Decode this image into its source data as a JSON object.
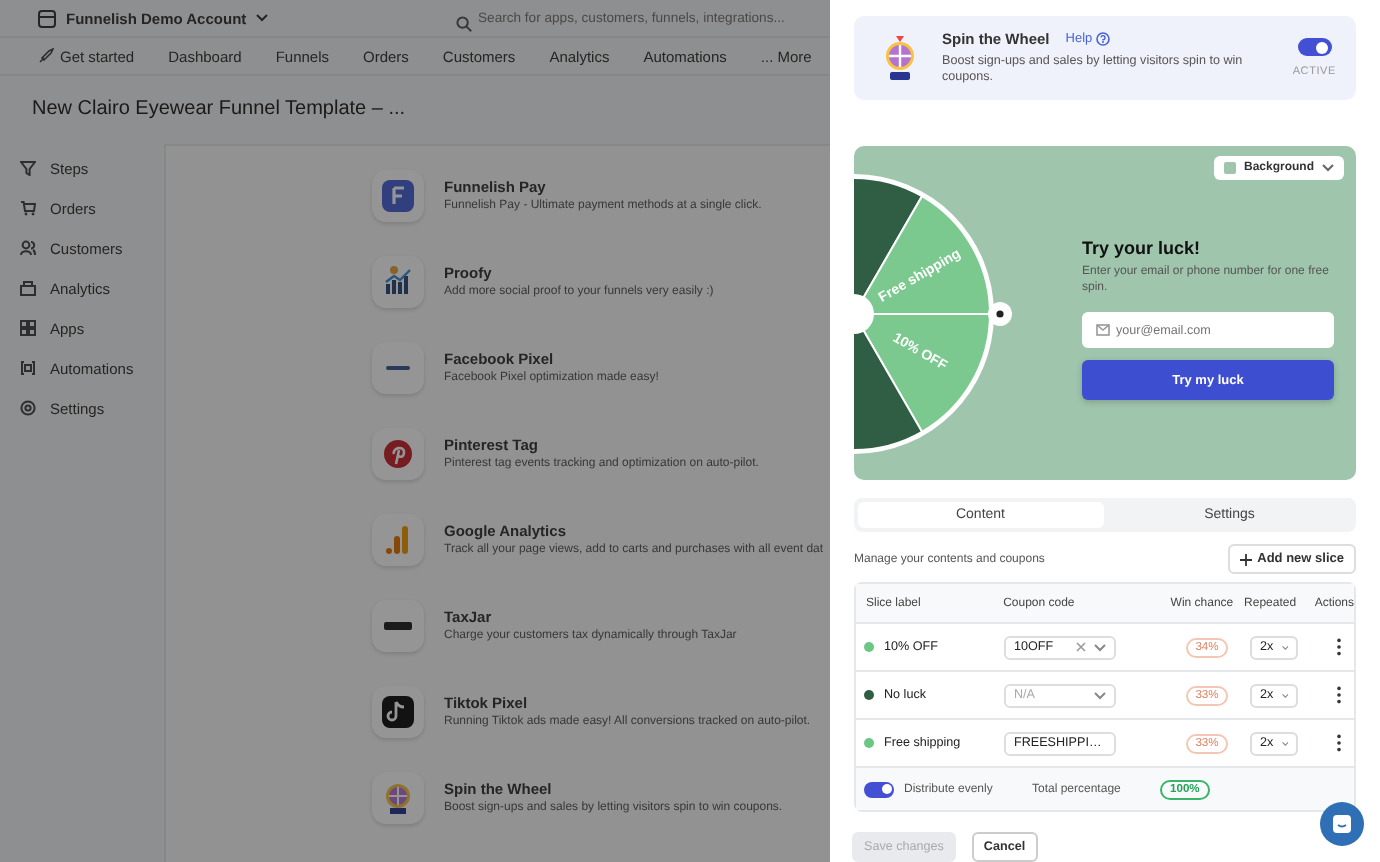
{
  "account": {
    "name": "Funnelish Demo Account"
  },
  "search": {
    "placeholder": "Search for apps, customers, funnels, integrations..."
  },
  "nav": [
    {
      "label": "Get started"
    },
    {
      "label": "Dashboard"
    },
    {
      "label": "Funnels"
    },
    {
      "label": "Orders"
    },
    {
      "label": "Customers"
    },
    {
      "label": "Analytics"
    },
    {
      "label": "Automations"
    },
    {
      "label": "... More"
    }
  ],
  "page_title": "New Clairo Eyewear Funnel Template – ...",
  "sidebar": {
    "items": [
      {
        "label": "Steps"
      },
      {
        "label": "Orders"
      },
      {
        "label": "Customers"
      },
      {
        "label": "Analytics"
      },
      {
        "label": "Apps"
      },
      {
        "label": "Automations"
      },
      {
        "label": "Settings"
      }
    ]
  },
  "apps": [
    {
      "name": "Funnelish Pay",
      "description": "Funnelish Pay - Ultimate payment methods at a single click."
    },
    {
      "name": "Proofy",
      "description": "Add more social proof to your funnels very easily :)"
    },
    {
      "name": "Facebook Pixel",
      "description": "Facebook Pixel optimization made easy!"
    },
    {
      "name": "Pinterest Tag",
      "description": "Pinterest tag events tracking and optimization on auto-pilot."
    },
    {
      "name": "Google Analytics",
      "description": "Track all your page views, add to carts and purchases with all event dat"
    },
    {
      "name": "TaxJar",
      "description": "Charge your customers tax dynamically through TaxJar"
    },
    {
      "name": "Tiktok Pixel",
      "description": "Running Tiktok ads made easy! All conversions tracked on auto-pilot."
    },
    {
      "name": "Spin the Wheel",
      "description": "Boost sign-ups and sales by letting visitors spin to win coupons."
    }
  ],
  "drawer": {
    "app": {
      "name": "Spin the Wheel",
      "help": "Help",
      "description": "Boost sign-ups and sales by letting visitors spin to win coupons.",
      "active": true,
      "status": "ACTIVE"
    },
    "preview": {
      "background_menu": "Background",
      "wheel_labels": [
        "Free shipping",
        "10% OFF"
      ],
      "heading": "Try your luck!",
      "text": "Enter your email or phone number for one free spin.",
      "email_placeholder": "your@email.com",
      "button": "Try my luck"
    },
    "tabs": [
      {
        "label": "Content",
        "selected": true
      },
      {
        "label": "Settings",
        "selected": false
      }
    ],
    "hint": "Manage your contents and coupons",
    "add_button": "Add new slice",
    "table": {
      "columns": [
        "Slice label",
        "Coupon code",
        "Win chance",
        "Repeated",
        "Actions"
      ],
      "rows": [
        {
          "label": "10% OFF",
          "color": "#6cc784",
          "coupon": "10OFF",
          "filled": true,
          "clearable": true,
          "chance": "34%",
          "repeated": "2x"
        },
        {
          "label": "No luck",
          "color": "#2f5e45",
          "coupon": "N/A",
          "filled": false,
          "clearable": false,
          "chance": "33%",
          "repeated": "2x"
        },
        {
          "label": "Free shipping",
          "color": "#6cc784",
          "coupon": "FREESHIPPI…",
          "filled": true,
          "clearable": false,
          "chance": "33%",
          "repeated": "2x"
        }
      ]
    },
    "footer": {
      "distribute_evenly": true,
      "distribute_label": "Distribute evenly",
      "total_label": "Total percentage",
      "total": "100%"
    },
    "save_button": {
      "label": "Save changes",
      "disabled": true
    },
    "cancel_button": {
      "label": "Cancel"
    }
  }
}
